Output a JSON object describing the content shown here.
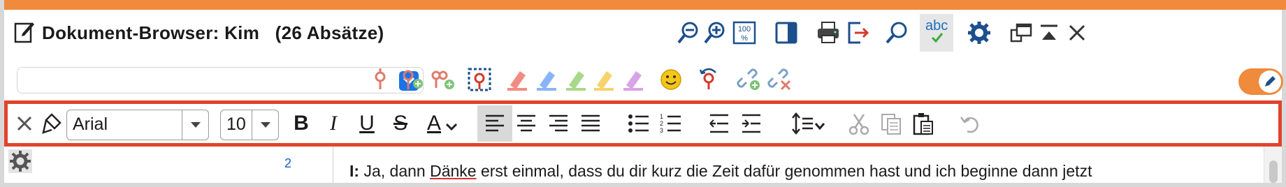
{
  "window": {
    "title": "Dokument-Browser: Kim   (26 Absätze)",
    "accent_color": "#f08a3c"
  },
  "title_toolbar": {
    "icons": [
      "zoom-out-icon",
      "zoom-in-icon",
      "zoom-100-icon",
      "sidebar-panel-icon",
      "print-icon",
      "export-icon",
      "search-icon",
      "spellcheck-icon",
      "settings-icon",
      "undock-icon",
      "collapse-icon",
      "close-icon"
    ],
    "zoom_100_label": "100\n%",
    "spellcheck_label": "abc"
  },
  "code_toolbar": {
    "code_select_value": "",
    "toggle_on": true,
    "highlighter_colors": [
      "#f28b82",
      "#8ab4f8",
      "#a8d98a",
      "#f7d36b",
      "#d9a3e8"
    ]
  },
  "format_toolbar": {
    "font_name": "Arial",
    "font_size": "10",
    "bold_label": "B",
    "italic_label": "I",
    "underline_label": "U",
    "strike_label": "S",
    "font_color_label": "A"
  },
  "document": {
    "paragraph_number": "2",
    "speaker": "I:",
    "text_before": " Ja, dann ",
    "misspelled": "Dänke",
    "text_after": " erst einmal, dass du dir kurz die Zeit dafür genommen hast und ich beginne dann jetzt"
  }
}
